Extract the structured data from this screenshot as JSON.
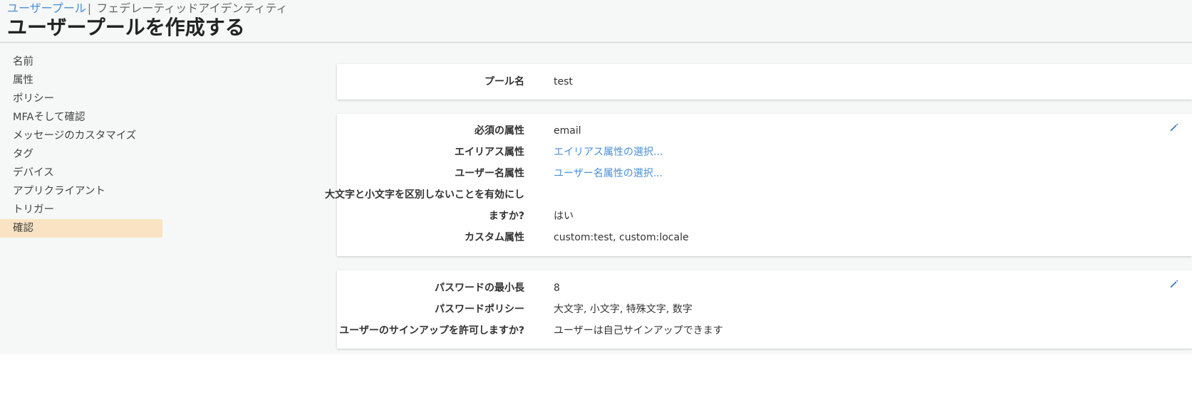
{
  "breadcrumb": {
    "user_pools": "ユーザープール",
    "separator": "|",
    "federated": "フェデレーティッドアイデンティティ"
  },
  "page_title": "ユーザープールを作成する",
  "sidebar": {
    "items": [
      {
        "label": "名前"
      },
      {
        "label": "属性"
      },
      {
        "label": "ポリシー"
      },
      {
        "label": "MFAそして確認"
      },
      {
        "label": "メッセージのカスタマイズ"
      },
      {
        "label": "タグ"
      },
      {
        "label": "デバイス"
      },
      {
        "label": "アプリクライアント"
      },
      {
        "label": "トリガー"
      },
      {
        "label": "確認"
      }
    ],
    "active": "確認"
  },
  "pool": {
    "name_label": "プール名",
    "name_value": "test"
  },
  "attributes": {
    "required_label": "必須の属性",
    "required_value": "email",
    "alias_label": "エイリアス属性",
    "alias_value": "エイリアス属性の選択...",
    "username_label": "ユーザー名属性",
    "username_value": "ユーザー名属性の選択...",
    "case_label_line1": "大文字と小文字を区別しないことを有効にし",
    "case_label_line2": "ますか?",
    "case_value": "はい",
    "custom_label": "カスタム属性",
    "custom_value": "custom:test, custom:locale"
  },
  "policies": {
    "min_length_label": "パスワードの最小長",
    "min_length_value": "8",
    "policy_label": "パスワードポリシー",
    "policy_value": "大文字, 小文字, 特殊文字, 数字",
    "signup_label": "ユーザーのサインアップを許可しますか?",
    "signup_value": "ユーザーは自己サインアップできます"
  },
  "colors": {
    "link": "#4a8fd6",
    "active_nav": "#f9e3c2",
    "edit_icon": "#3f7fc4"
  },
  "icons": {
    "edit": "pencil-icon"
  }
}
